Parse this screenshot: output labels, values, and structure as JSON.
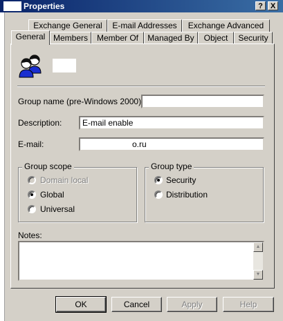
{
  "window": {
    "title": "Properties",
    "help_btn": "?",
    "close_btn": "X"
  },
  "tabs_row1": [
    "Exchange General",
    "E-mail Addresses",
    "Exchange Advanced"
  ],
  "tabs_row2": [
    "General",
    "Members",
    "Member Of",
    "Managed By",
    "Object",
    "Security"
  ],
  "active_tab": "General",
  "general": {
    "group_icon": "group-users-icon",
    "pre2000_label": "Group name (pre-Windows 2000):",
    "description_label": "Description:",
    "description_value": "E-mail enable",
    "email_label": "E-mail:",
    "email_value": "o.ru",
    "group_scope": {
      "legend": "Group scope",
      "options": [
        "Domain local",
        "Global",
        "Universal"
      ],
      "selected": "Global",
      "disabled": [
        "Domain local"
      ]
    },
    "group_type": {
      "legend": "Group type",
      "options": [
        "Security",
        "Distribution"
      ],
      "selected": "Security"
    },
    "notes_label": "Notes:"
  },
  "buttons": {
    "ok": "OK",
    "cancel": "Cancel",
    "apply": "Apply",
    "help": "Help"
  },
  "colors": {
    "title_bar": "#0a246a",
    "face": "#d4d0c8",
    "icon_blue": "#1a2fd0"
  }
}
